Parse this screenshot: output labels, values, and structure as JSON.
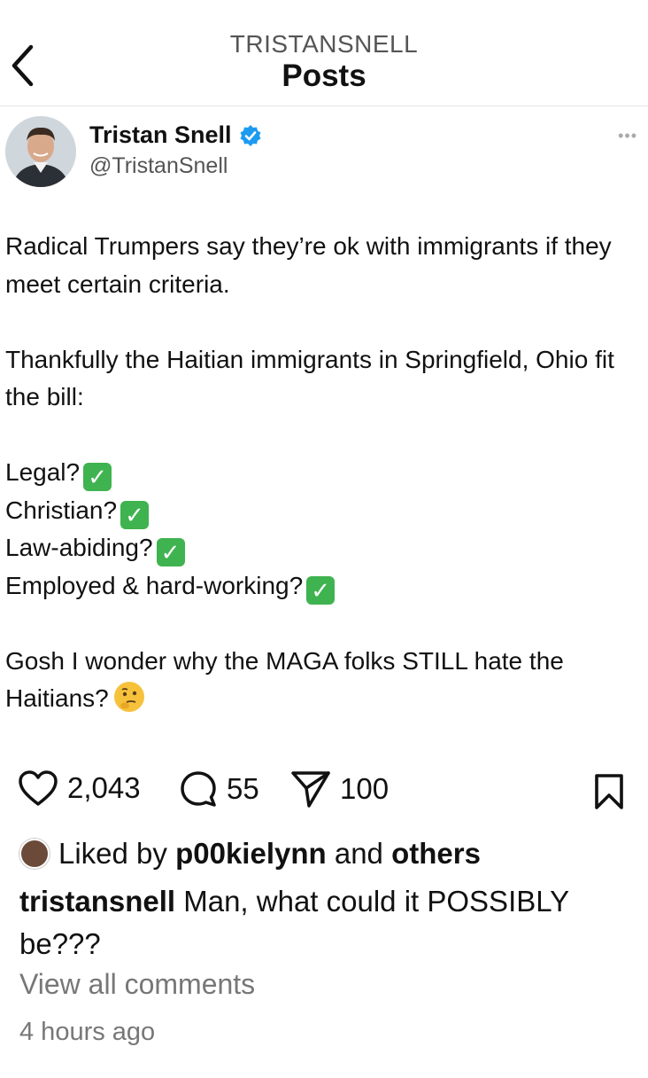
{
  "header": {
    "username": "TRISTANSNELL",
    "title": "Posts"
  },
  "tweet": {
    "author_name": "Tristan Snell",
    "author_handle": "@TristanSnell",
    "more": "•••",
    "paragraph_1": "Radical Trumpers say they’re ok with immigrants if they meet certain criteria.",
    "paragraph_2": "Thankfully the Haitian immigrants in Springfield, Ohio fit the bill:",
    "criteria": [
      "Legal?",
      "Christian?",
      "Law-abiding?",
      "Employed & hard-working?"
    ],
    "check_glyph": "✓",
    "paragraph_3": "Gosh I wonder why the MAGA folks STILL hate the Haitians?"
  },
  "actions": {
    "likes": "2,043",
    "comments": "55",
    "shares": "100"
  },
  "liked_by": {
    "prefix": "Liked by",
    "user": "p00kielynn",
    "middle": "and",
    "others": "others"
  },
  "caption": {
    "username": "tristansnell",
    "text": "Man, what could it POSSIBLY be???"
  },
  "view_comments": "View all comments",
  "timestamp": "4 hours ago",
  "colors": {
    "verified_badge": "#1d9bf0",
    "check_emoji": "#3fb34f",
    "secondary_text": "#777777"
  }
}
